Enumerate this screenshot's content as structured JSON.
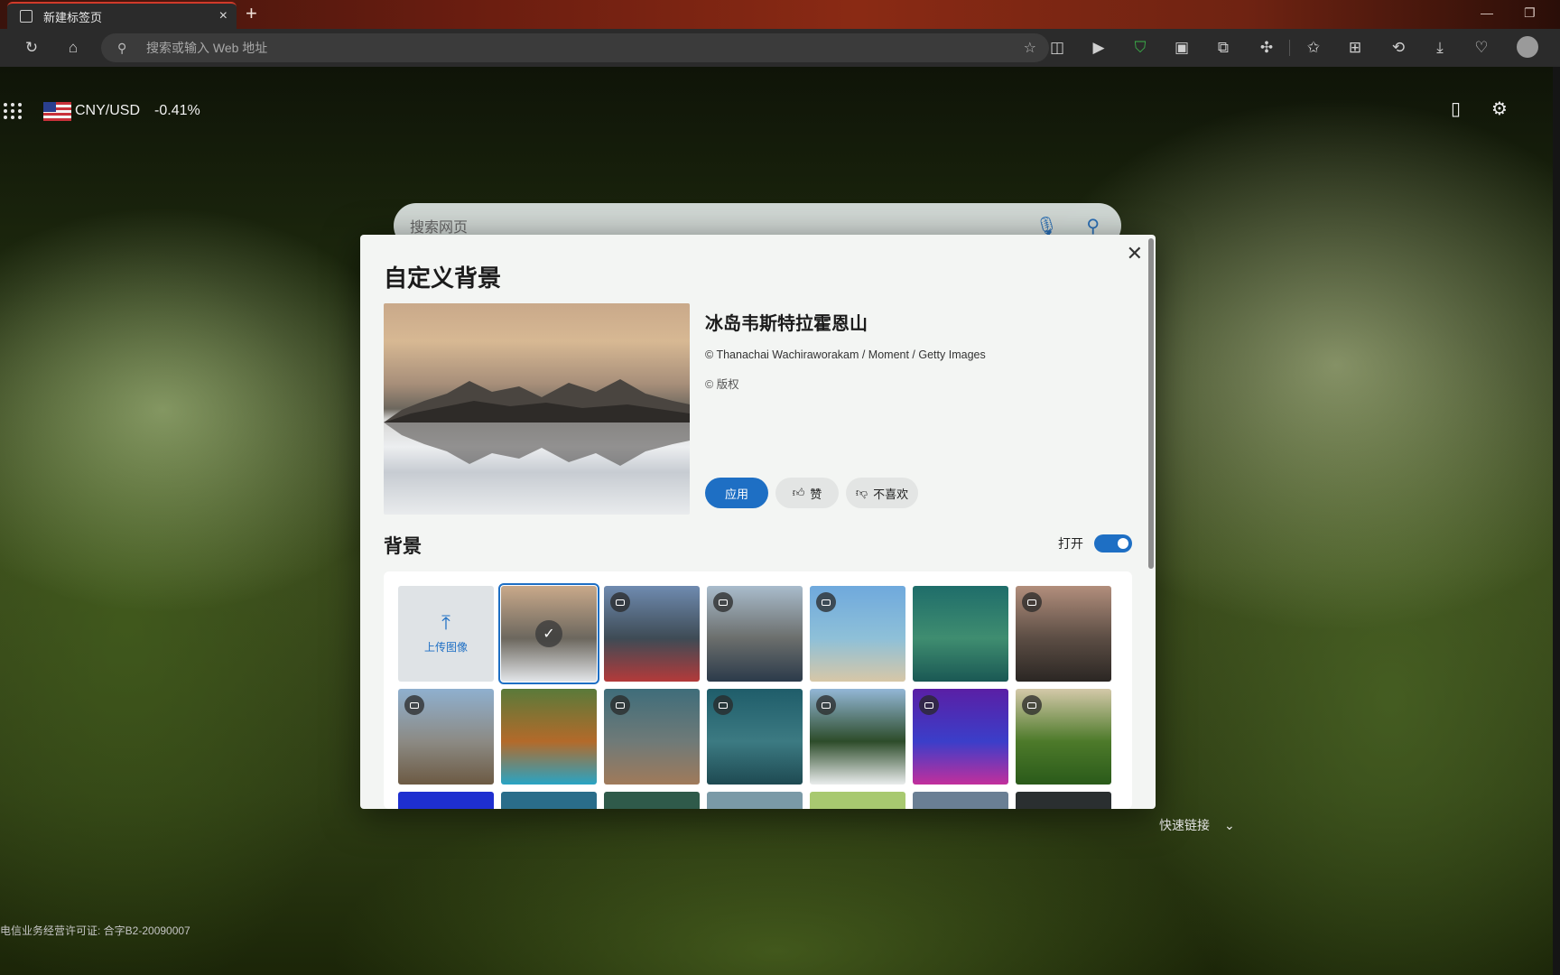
{
  "browser": {
    "tab_title": "新建标签页",
    "tab_close": "×",
    "new_tab": "+",
    "address_placeholder": "搜索或输入 Web 地址"
  },
  "newtab": {
    "currency_pair": "CNY/USD",
    "currency_change": "-0.41%",
    "search_placeholder": "搜索网页",
    "quick_links_label": "快速链接",
    "license": "电信业务经营许可证: 合字B2-20090007"
  },
  "dialog": {
    "title": "自定义背景",
    "close": "✕",
    "image_title": "冰岛韦斯特拉霍恩山",
    "credit": "© Thanachai Wachiraworakam / Moment / Getty Images",
    "copyright": "© 版权",
    "apply_label": "应用",
    "like_label": "赞",
    "dislike_label": "不喜欢",
    "section_title": "背景",
    "toggle_label": "打开",
    "toggle_on": true,
    "upload_label": "上传图像"
  },
  "thumbnails": [
    {
      "name": "upload",
      "video": false
    },
    {
      "name": "iceland-vestrahorn",
      "video": false,
      "selected": true,
      "colors": [
        "#c9a98a",
        "#6c675e",
        "#e3e6e9"
      ]
    },
    {
      "name": "mount-fuji-flowers",
      "video": true,
      "colors": [
        "#6f8bb0",
        "#3e4b55",
        "#b43a3a"
      ]
    },
    {
      "name": "coastal-town",
      "video": true,
      "colors": [
        "#a9bccc",
        "#6b6e6c",
        "#2b3a4a"
      ]
    },
    {
      "name": "beach",
      "video": true,
      "colors": [
        "#6fa9dd",
        "#8ec0d8",
        "#d7c7a7"
      ]
    },
    {
      "name": "aerial-circle",
      "video": false,
      "colors": [
        "#1f6d6a",
        "#3f8d70",
        "#1a5854"
      ]
    },
    {
      "name": "misty-cliff",
      "video": true,
      "colors": [
        "#b28e7c",
        "#5b4d44",
        "#2b2623"
      ]
    },
    {
      "name": "city-bridge",
      "video": true,
      "colors": [
        "#8fb0cf",
        "#8c8a84",
        "#6c5a43"
      ]
    },
    {
      "name": "coast-cliffs",
      "video": false,
      "colors": [
        "#5a7a3a",
        "#b36a2a",
        "#29a4c4"
      ]
    },
    {
      "name": "desert-hills",
      "video": true,
      "colors": [
        "#3f6d7a",
        "#6f7a78",
        "#a07a5a"
      ]
    },
    {
      "name": "lake-aerial",
      "video": true,
      "colors": [
        "#1f5d6a",
        "#3c7a82",
        "#1e4a52"
      ]
    },
    {
      "name": "waterfall-forest",
      "video": true,
      "colors": [
        "#93b7d6",
        "#2d4c2a",
        "#e9ecec"
      ]
    },
    {
      "name": "purple-abstract",
      "video": true,
      "colors": [
        "#5a1fa5",
        "#3b3ec9",
        "#c22f9c"
      ]
    },
    {
      "name": "vineyard-mountain",
      "video": true,
      "colors": [
        "#d4c9a9",
        "#4d7a2a",
        "#2a5a1a"
      ]
    },
    {
      "name": "row3-a",
      "video": false,
      "colors": [
        "#1e2fd0",
        "#1e2fd0",
        "#1e2fd0"
      ]
    },
    {
      "name": "row3-b",
      "video": false,
      "colors": [
        "#2a6d8a",
        "#2a6d8a",
        "#2a6d8a"
      ]
    },
    {
      "name": "row3-c",
      "video": false,
      "colors": [
        "#2f5a4a",
        "#2f5a4a",
        "#2f5a4a"
      ]
    },
    {
      "name": "row3-d",
      "video": false,
      "colors": [
        "#7a9aa7",
        "#7a9aa7",
        "#7a9aa7"
      ]
    },
    {
      "name": "row3-e",
      "video": false,
      "colors": [
        "#a8c970",
        "#a8c970",
        "#a8c970"
      ]
    },
    {
      "name": "row3-f",
      "video": false,
      "colors": [
        "#6a7f94",
        "#6a7f94",
        "#6a7f94"
      ]
    },
    {
      "name": "row3-g",
      "video": false,
      "colors": [
        "#2a2f30",
        "#2a2f30",
        "#2a2f30"
      ]
    }
  ],
  "colors": {
    "accent": "#1e6fc4",
    "tab_accent": "#d13a2a"
  }
}
